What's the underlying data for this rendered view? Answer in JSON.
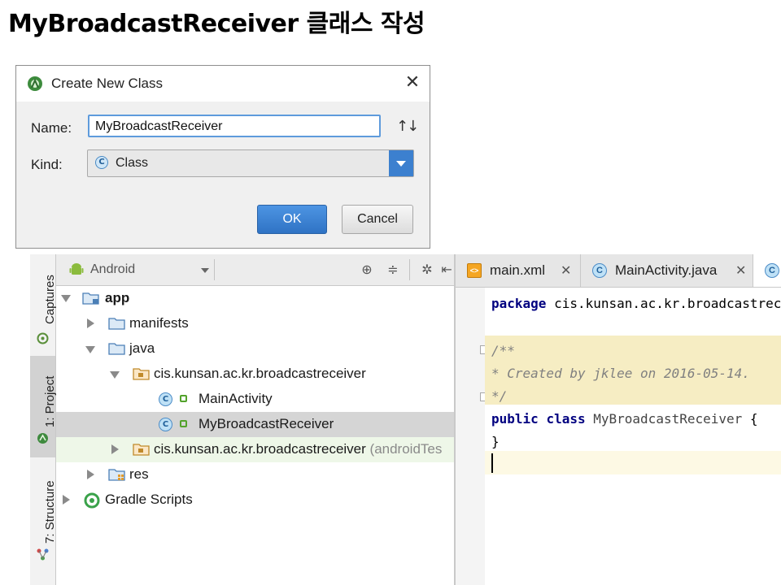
{
  "slide": {
    "title": "MyBroadcastReceiver 클래스 작성"
  },
  "dialog": {
    "title": "Create New Class",
    "name_label": "Name:",
    "name_value": "MyBroadcastReceiver",
    "kind_label": "Kind:",
    "kind_value": "Class",
    "ok_label": "OK",
    "cancel_label": "Cancel",
    "close_glyph": "✕",
    "sort_glyph": "↑↓"
  },
  "sidebar": {
    "tabs": [
      {
        "label": "Captures"
      },
      {
        "label": "1: Project",
        "active": true
      },
      {
        "label": "7: Structure"
      }
    ]
  },
  "project_panel": {
    "view_selector": "Android",
    "tree": [
      {
        "label": "app",
        "bold": true
      },
      {
        "label": "manifests"
      },
      {
        "label": "java"
      },
      {
        "label": "cis.kunsan.ac.kr.broadcastreceiver"
      },
      {
        "label": "MainActivity"
      },
      {
        "label": "MyBroadcastReceiver",
        "selected": true
      },
      {
        "label": "cis.kunsan.ac.kr.broadcastreceiver",
        "suffix": "(androidTes"
      },
      {
        "label": "res"
      },
      {
        "label": "Gradle Scripts"
      }
    ]
  },
  "editor": {
    "tabs": [
      {
        "label": "main.xml",
        "icon": "xml-file-icon"
      },
      {
        "label": "MainActivity.java",
        "icon": "java-class-icon"
      }
    ],
    "code": {
      "package_kw": "package",
      "package_name": "cis.kunsan.ac.kr.broadcastrece",
      "comment_open": "/**",
      "comment_body": " * Created by jklee on 2016-05-14.",
      "comment_close": " */",
      "public_kw": "public",
      "class_kw": "class",
      "class_name": "MyBroadcastReceiver",
      "open_brace": "{",
      "close_brace": "}"
    }
  },
  "colors": {
    "accent": "#3c80cf",
    "selection": "#d5d5d5",
    "comment_bg": "#f6edc3",
    "keyword": "#000080"
  }
}
